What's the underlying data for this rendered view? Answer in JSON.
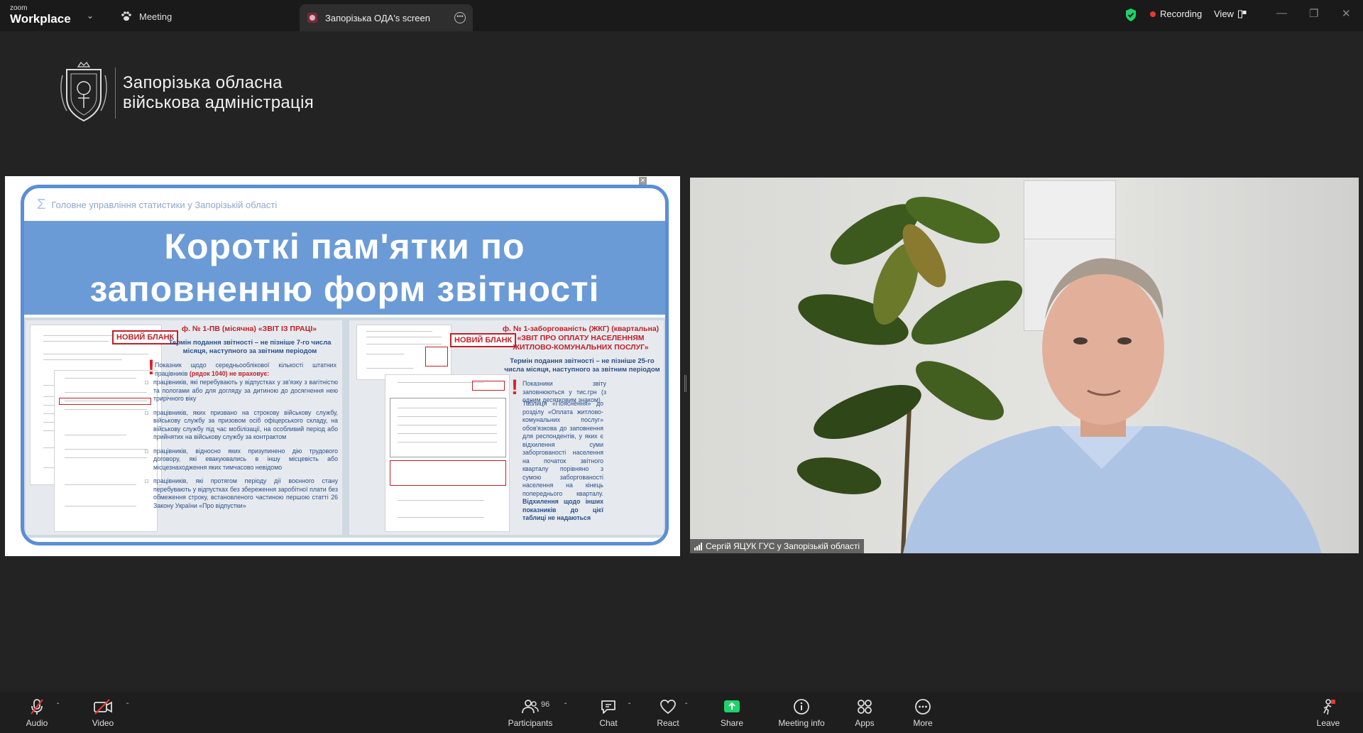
{
  "titlebar": {
    "brand_top": "zoom",
    "brand_bottom": "Workplace",
    "tab_meeting": "Meeting",
    "tab_share": "Запорізька ОДА's screen",
    "recording": "Recording",
    "view": "View"
  },
  "org": {
    "line1": "Запорізька обласна",
    "line2": "військова адміністрація"
  },
  "slide": {
    "header": "Головне управління статистики у Запорізькій області",
    "title_line1": "Короткі пам'ятки по",
    "title_line2": "заповненню форм звітності",
    "left": {
      "new_blank": "НОВИЙ БЛАНК",
      "form_title": "ф. № 1-ПВ (місячна) «ЗВІТ ІЗ ПРАЦІ»",
      "deadline": "Термін подання звітності – не пізніше 7-го числа місяця, наступного за звітним періодом",
      "intro": "Показник щодо середньооблікової кількості штатних працівників",
      "intro_bold": "(рядок 1040) не враховує:",
      "bullets": [
        "працівників, які перебувають у відпустках у зв'язку з вагітністю та пологами або для догляду за дитиною до досягнення нею трирічного віку",
        "працівників, яких призвано на строкову військову службу, військову службу за призовом осіб офіцерського складу, на військову службу під час мобілізації, на особливий період або прийнятих на військову службу за контрактом",
        "працівників, відносно яких призупинено дію трудового договору, які евакуювались в іншу місцевість або місцезнаходження яких тимчасово невідомо",
        "працівників, які протягом періоду дії воєнного стану перебувають у відпустках без збереження заробітної плати без обмеження строку, встановленого частиною першою статті 26 Закону України «Про відпустки»"
      ]
    },
    "right": {
      "new_blank": "НОВИЙ БЛАНК",
      "form_title_1": "ф. № 1-заборгованість (ЖКГ) (квартальна)",
      "form_title_2": "«ЗВІТ ПРО ОПЛАТУ НАСЕЛЕННЯМ ЖИТЛОВО-КОМУНАЛЬНИХ ПОСЛУГ»",
      "deadline": "Термін подання звітності – не пізніше 25-го числа місяця, наступного за звітним періодом",
      "note": "Показники звіту заповнюються у тис.грн (з одним десятковим знаком)",
      "text": "Таблиця «Пояснення» до розділу «Оплата житлово-комунальних послуг» обов'язкова до заповнення для респондентів, у яких є відхилення суми заборгованості населення на початок звітного кварталу порівняно з сумою заборгованості населення на кінець попереднього кварталу.",
      "text_bold": "Відхилення щодо інших показників до цієї таблиці не надаються"
    }
  },
  "video": {
    "name": "Сергій ЯЦУК ГУС у Запорізькій області"
  },
  "toolbar": {
    "audio": "Audio",
    "video": "Video",
    "participants": "Participants",
    "participants_count": "96",
    "chat": "Chat",
    "react": "React",
    "share": "Share",
    "meeting_info": "Meeting info",
    "apps": "Apps",
    "more": "More",
    "leave": "Leave"
  },
  "colors": {
    "accent_green": "#1fd26a",
    "recording_red": "#e53935",
    "slide_blue": "#6b9bd6",
    "slide_border": "#5b8ed6",
    "slide_red": "#c0202a"
  }
}
